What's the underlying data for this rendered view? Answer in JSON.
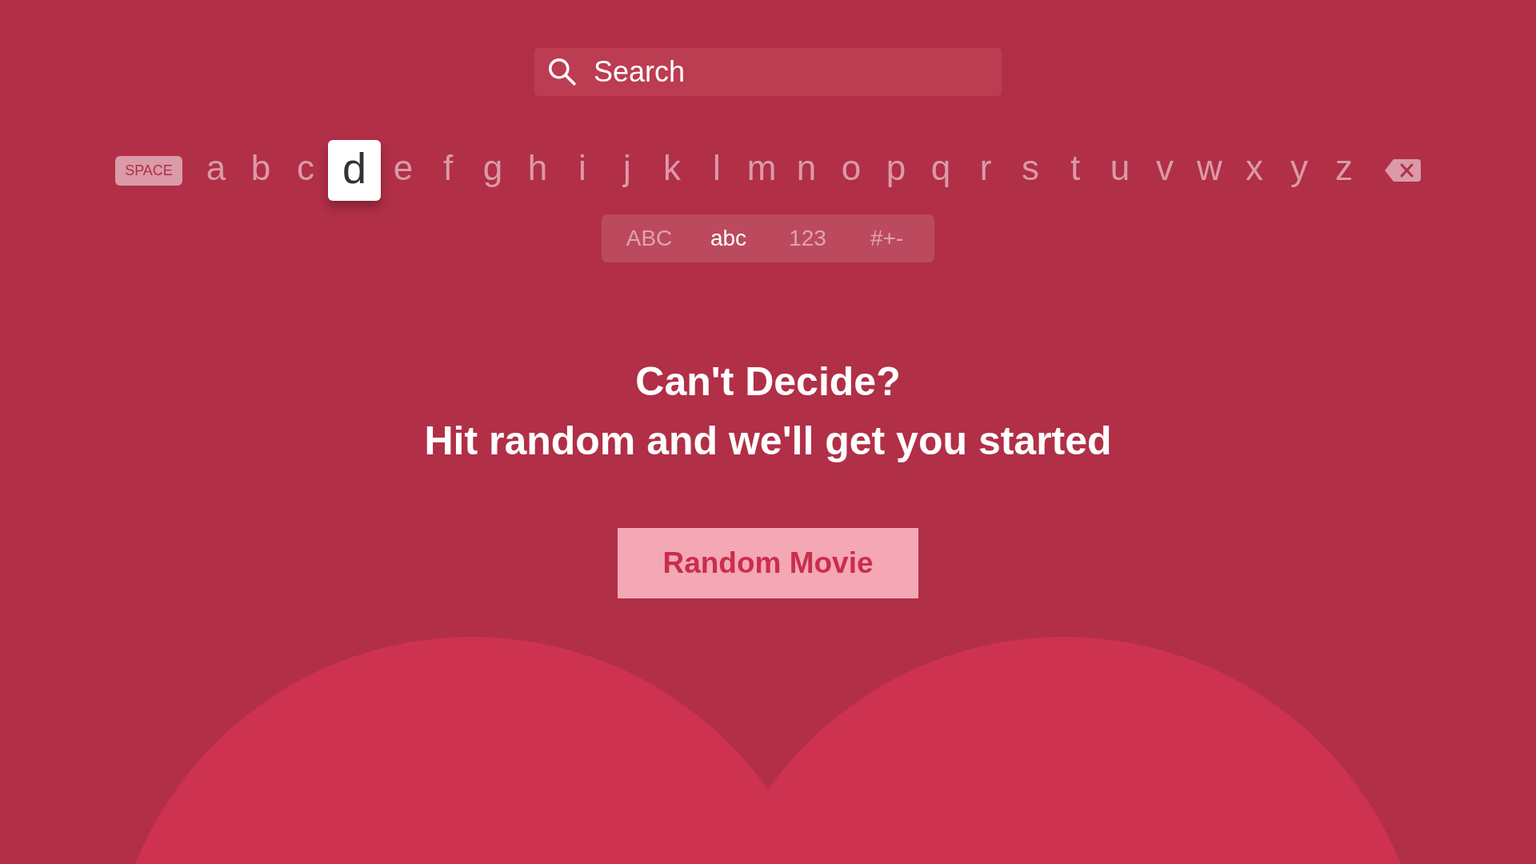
{
  "search": {
    "placeholder": "Search"
  },
  "keyboard": {
    "space_key": "SPACE",
    "keys": [
      {
        "label": "a",
        "selected": false
      },
      {
        "label": "b",
        "selected": false
      },
      {
        "label": "c",
        "selected": false
      },
      {
        "label": "d",
        "selected": true
      },
      {
        "label": "e",
        "selected": false
      },
      {
        "label": "f",
        "selected": false
      },
      {
        "label": "g",
        "selected": false
      },
      {
        "label": "h",
        "selected": false
      },
      {
        "label": "i",
        "selected": false
      },
      {
        "label": "j",
        "selected": false
      },
      {
        "label": "k",
        "selected": false
      },
      {
        "label": "l",
        "selected": false
      },
      {
        "label": "m",
        "selected": false
      },
      {
        "label": "n",
        "selected": false
      },
      {
        "label": "o",
        "selected": false
      },
      {
        "label": "p",
        "selected": false
      },
      {
        "label": "q",
        "selected": false
      },
      {
        "label": "r",
        "selected": false
      },
      {
        "label": "s",
        "selected": false
      },
      {
        "label": "t",
        "selected": false
      },
      {
        "label": "u",
        "selected": false
      },
      {
        "label": "v",
        "selected": false
      },
      {
        "label": "w",
        "selected": false
      },
      {
        "label": "x",
        "selected": false
      },
      {
        "label": "y",
        "selected": false
      },
      {
        "label": "z",
        "selected": false
      }
    ]
  },
  "modes": [
    {
      "label": "ABC",
      "selected": false
    },
    {
      "label": "abc",
      "selected": true
    },
    {
      "label": "123",
      "selected": false
    },
    {
      "label": "#+-",
      "selected": false
    }
  ],
  "heading": [
    "Can't Decide?",
    "Hit random and we'll get you started"
  ],
  "random_button": "Random Movie"
}
